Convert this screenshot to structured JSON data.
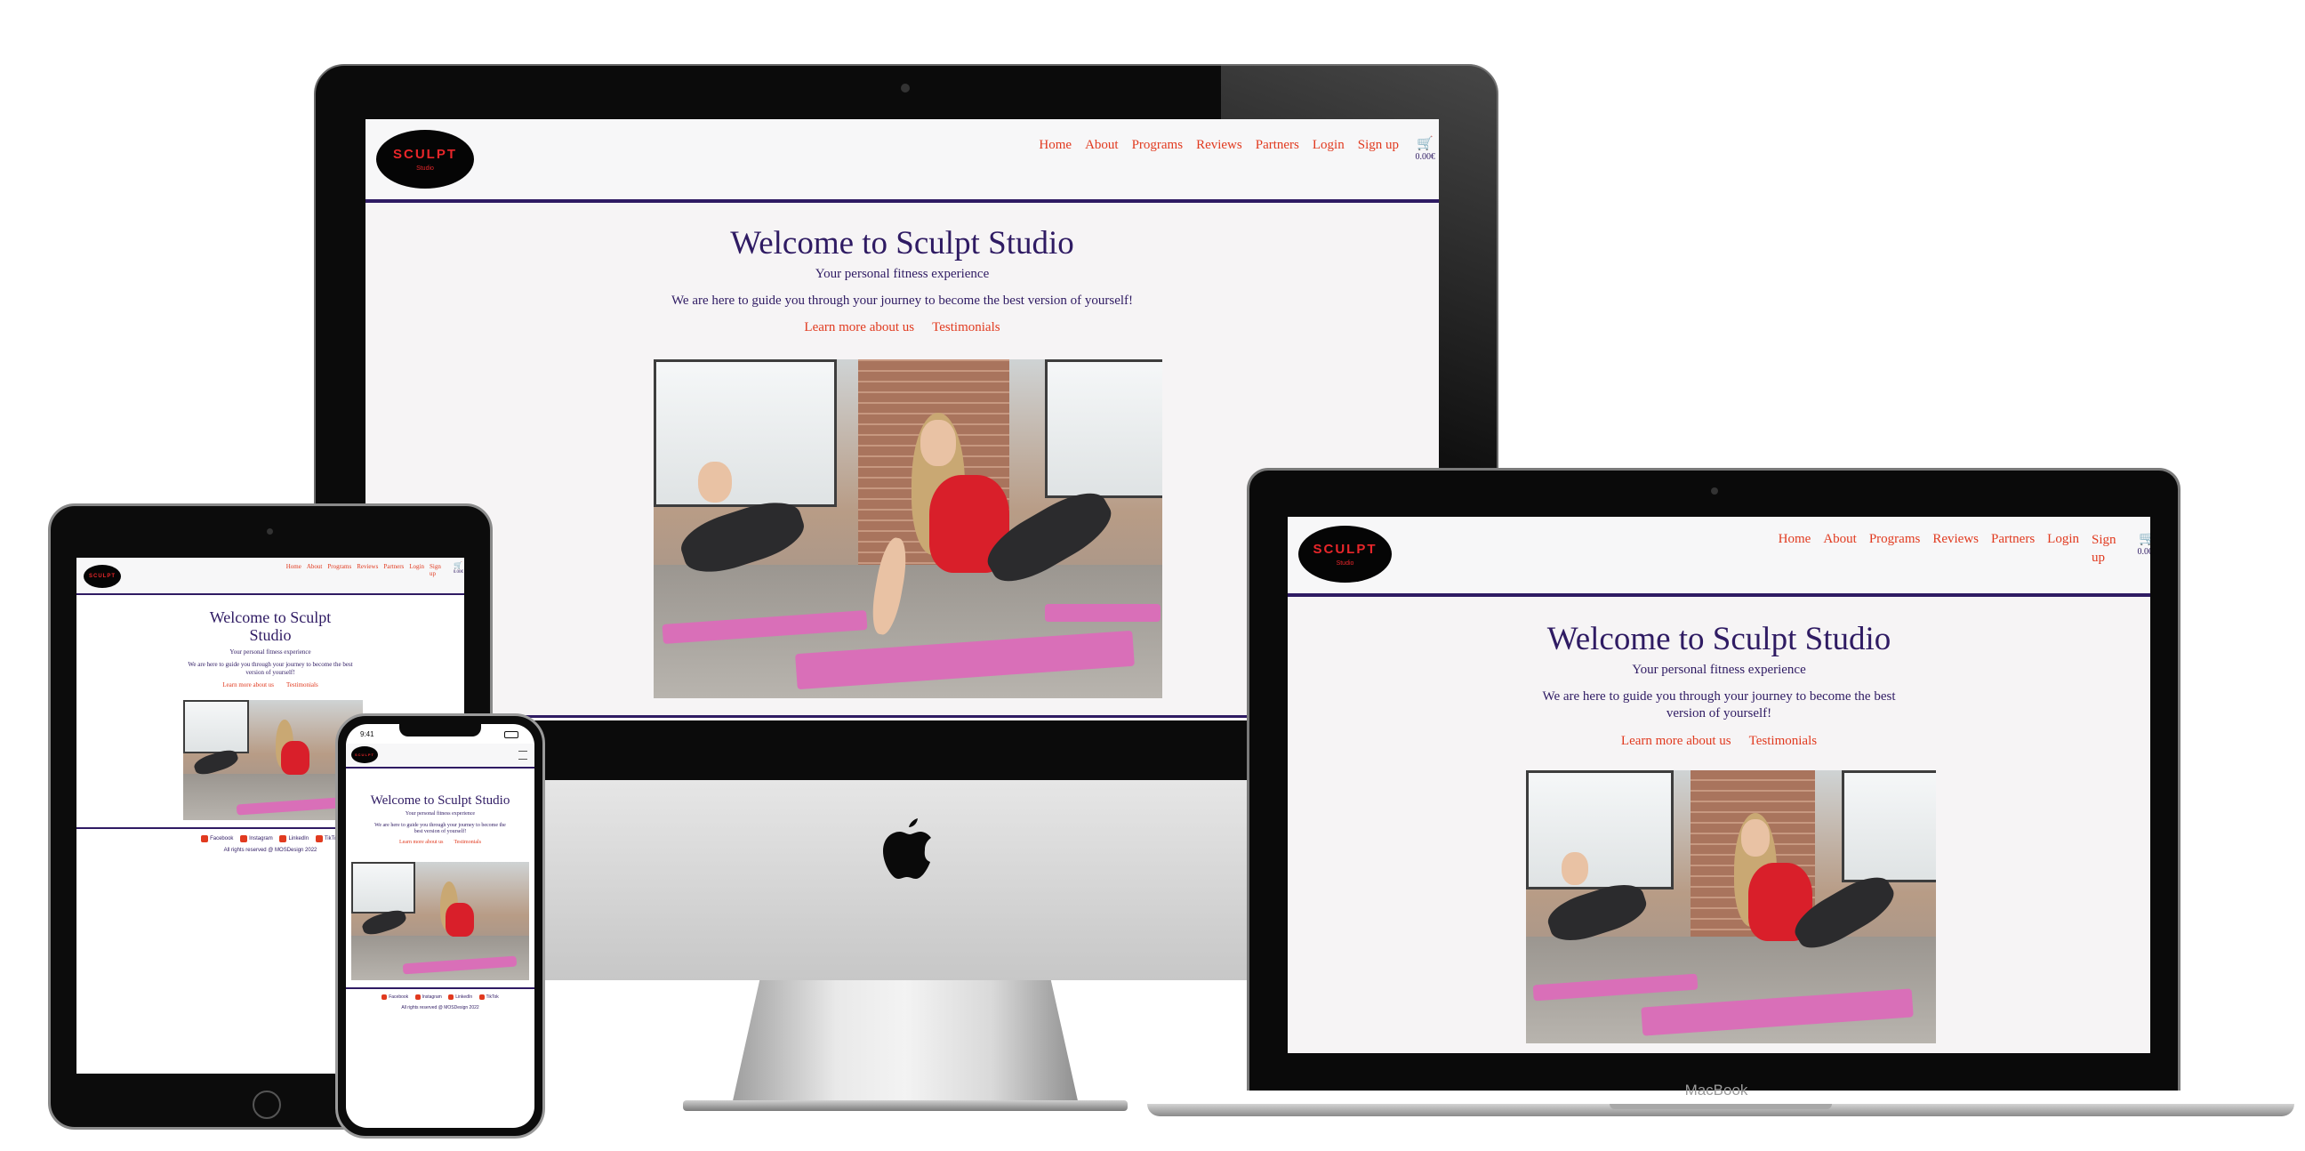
{
  "site": {
    "logo_text": "SCULPT",
    "logo_sub": "Studio",
    "nav": [
      "Home",
      "About",
      "Programs",
      "Reviews",
      "Partners",
      "Login",
      "Sign up"
    ],
    "cart_icon": "cart-icon",
    "cart_total": "0.00€",
    "title": "Welcome to Sculpt Studio",
    "subtitle": "Your personal fitness experience",
    "description": "We are here to guide you through your journey to become the best version of yourself!",
    "link_about": "Learn more about us",
    "link_testimonials": "Testimonials",
    "footer_social": [
      "Facebook",
      "Instagram",
      "LinkedIn",
      "TikTok"
    ],
    "copyright": "All rights reserved @ MOSDesign 2022",
    "colors": {
      "primary": "#2f1b63",
      "accent": "#e13a1f",
      "logo_bg": "#050505",
      "logo_text": "#e8262a"
    }
  },
  "devices": {
    "laptop_brand": "MacBook",
    "phone_time": "9:41",
    "imac_logo": "apple-icon"
  }
}
